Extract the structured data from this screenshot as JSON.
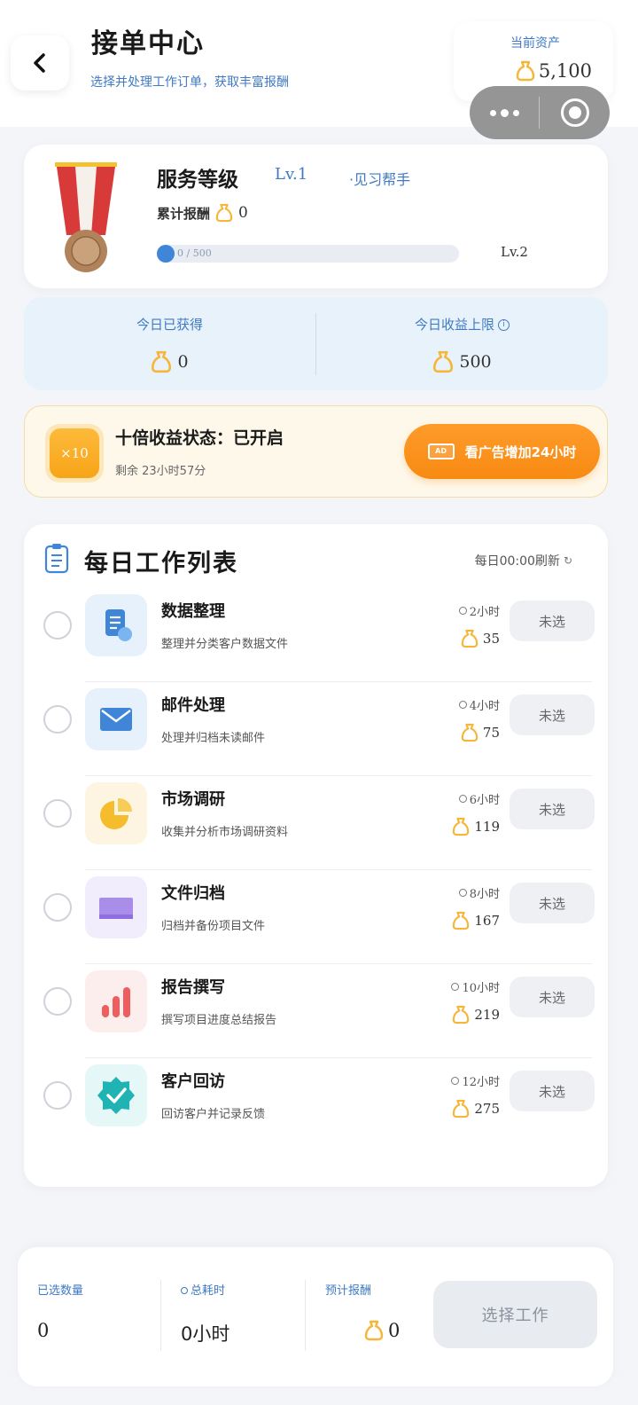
{
  "header": {
    "title": "接单中心",
    "subtitle": "选择并处理工作订单，获取丰富报酬",
    "asset_label": "当前资产",
    "asset_value": "5,100"
  },
  "level": {
    "name": "服务等级",
    "lv": "Lv.1",
    "rank": "·见习帮手",
    "total_label": "累计报酬",
    "total_value": "0",
    "progress_text": "0 / 500",
    "progress_fraction": 0,
    "next_level": "Lv.2"
  },
  "earnings": {
    "today_label": "今日已获得",
    "today_value": "0",
    "limit_label": "今日收益上限",
    "limit_value": "500"
  },
  "boost": {
    "badge": "×10",
    "status_label": "十倍收益状态：已开启",
    "remaining": "剩余 23小时57分",
    "ad_button": "看广告增加24小时",
    "ad_icon_text": "AD"
  },
  "work_list": {
    "title": "每日工作列表",
    "refresh": "每日00:00刷新",
    "items": [
      {
        "name": "数据整理",
        "desc": "整理并分类客户数据文件",
        "hours": "2小时",
        "reward": "35",
        "status": "未选",
        "icon": "document-icon",
        "tile_color": "#e6f1fc"
      },
      {
        "name": "邮件处理",
        "desc": "处理并归档未读邮件",
        "hours": "4小时",
        "reward": "75",
        "status": "未选",
        "icon": "mail-icon",
        "tile_color": "#e6f1fc"
      },
      {
        "name": "市场调研",
        "desc": "收集并分析市场调研资料",
        "hours": "6小时",
        "reward": "119",
        "status": "未选",
        "icon": "pie-icon",
        "tile_color": "#fdf5e2"
      },
      {
        "name": "文件归档",
        "desc": "归档并备份项目文件",
        "hours": "8小时",
        "reward": "167",
        "status": "未选",
        "icon": "folder-icon",
        "tile_color": "#f1edfd"
      },
      {
        "name": "报告撰写",
        "desc": "撰写项目进度总结报告",
        "hours": "10小时",
        "reward": "219",
        "status": "未选",
        "icon": "bar-chart-icon",
        "tile_color": "#fdeeee"
      },
      {
        "name": "客户回访",
        "desc": "回访客户并记录反馈",
        "hours": "12小时",
        "reward": "275",
        "status": "未选",
        "icon": "verified-badge-icon",
        "tile_color": "#e6f7f7"
      }
    ]
  },
  "summary": {
    "count_label": "已选数量",
    "count_value": "0",
    "time_label": "总耗时",
    "time_value": "0小时",
    "reward_label": "预计报酬",
    "reward_value": "0",
    "select_button": "选择工作"
  },
  "colors": {
    "accent_blue": "#3f7ac2",
    "orange": "#f78a12",
    "gold": "#f5b63a"
  }
}
